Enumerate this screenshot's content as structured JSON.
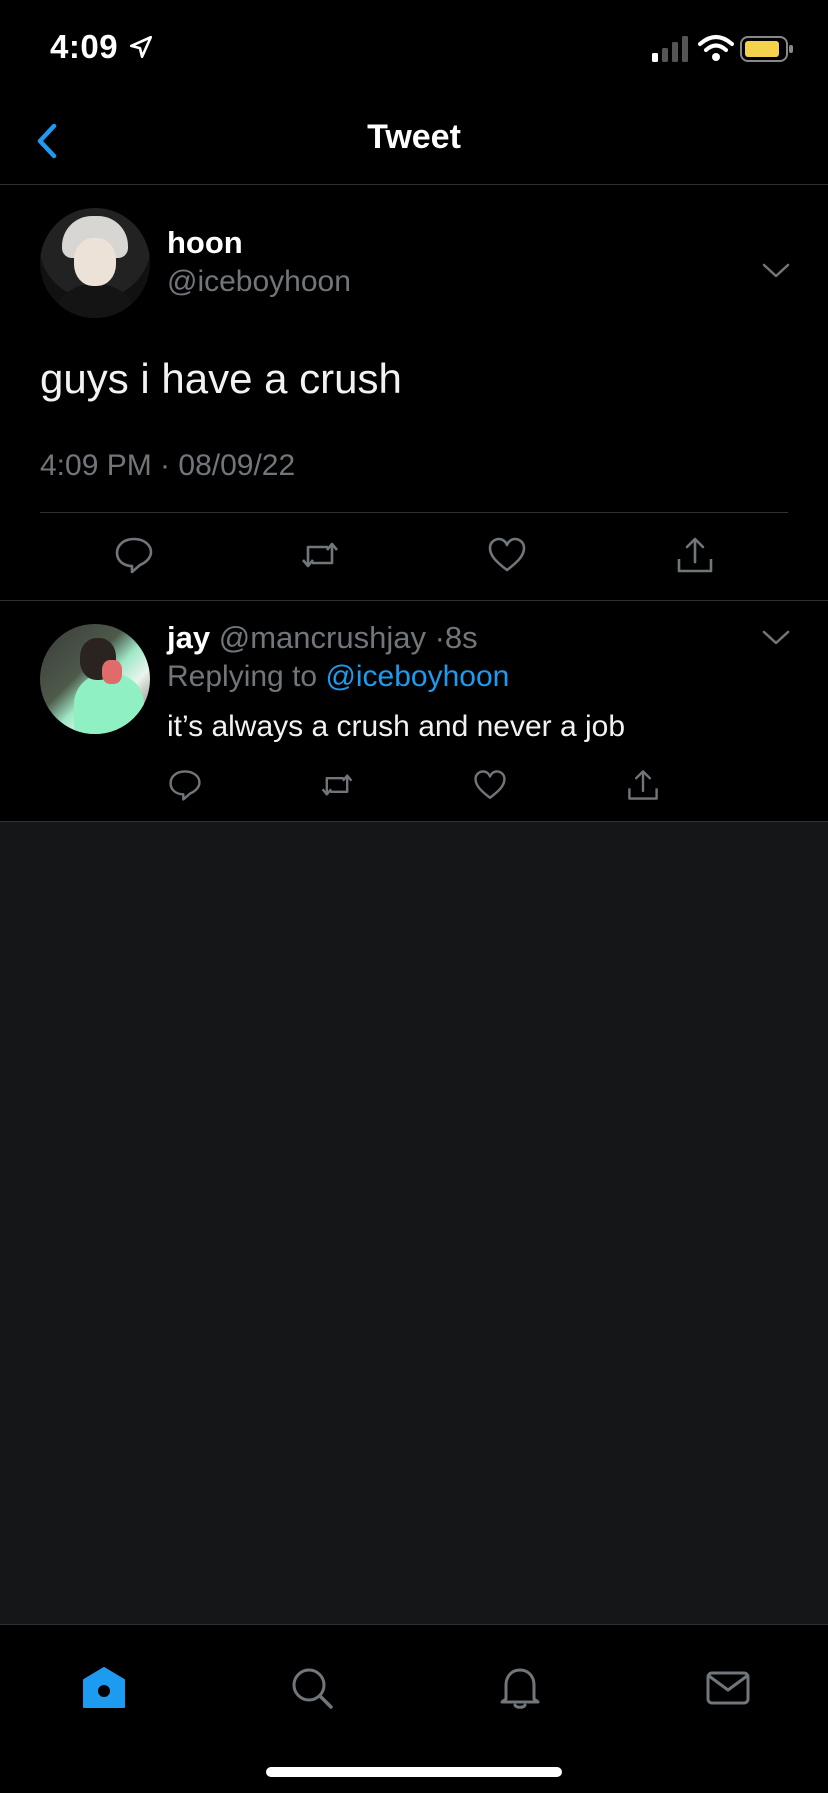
{
  "status_bar": {
    "time": "4:09",
    "battery_color": "#f4d24b"
  },
  "nav": {
    "title": "Tweet",
    "back_icon": "chevron-left-icon"
  },
  "main_tweet": {
    "display_name": "hoon",
    "handle": "@iceboyhoon",
    "text": "guys i have a crush",
    "timestamp": "4:09 PM · 08/09/22",
    "actions": [
      "reply-icon",
      "retweet-icon",
      "like-icon",
      "share-icon"
    ]
  },
  "reply": {
    "display_name": "jay",
    "handle": "@mancrushjay",
    "separator": "·",
    "age": "8s",
    "replying_prefix": "Replying to ",
    "replying_handle": "@iceboyhoon",
    "text": "it’s always a crush and never a job",
    "actions": [
      "reply-icon",
      "retweet-icon",
      "like-icon",
      "share-icon"
    ]
  },
  "tab_bar": {
    "tabs": [
      "home-icon",
      "search-icon",
      "notifications-icon",
      "messages-icon"
    ],
    "active_color": "#1d9bf0"
  },
  "colors": {
    "accent": "#1d9bf0",
    "secondary_text": "#71767b",
    "divider": "#2f3336",
    "empty_background": "#151618"
  }
}
